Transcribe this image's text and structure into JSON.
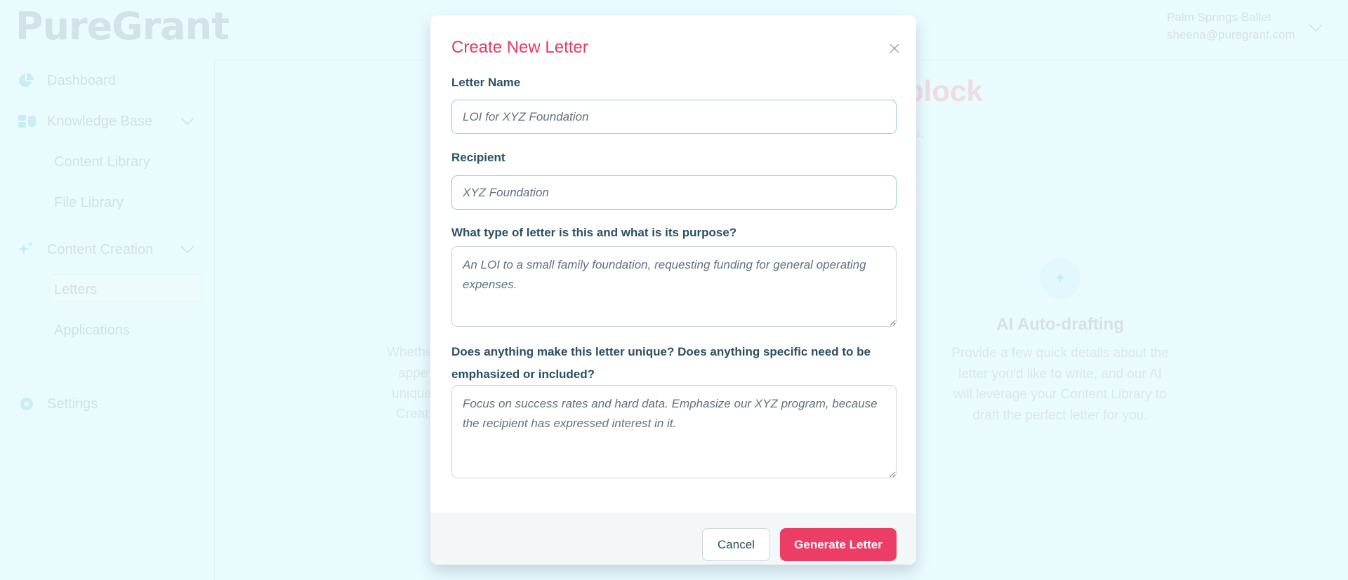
{
  "app": {
    "logo": "PureGrant"
  },
  "sidebar": {
    "items": [
      {
        "label": "Dashboard",
        "icon": "pie-chart-icon"
      },
      {
        "label": "Knowledge Base",
        "icon": "grid-icon",
        "expanded": true,
        "children": [
          {
            "label": "Content Library"
          },
          {
            "label": "File Library"
          }
        ]
      },
      {
        "label": "Content Creation",
        "icon": "sparkles-icon",
        "expanded": true,
        "children": [
          {
            "label": "Letters",
            "active": true
          },
          {
            "label": "Applications"
          }
        ]
      },
      {
        "label": "Settings",
        "icon": "gear-icon"
      }
    ]
  },
  "header": {
    "org": "Palm Springs Ballet",
    "email": "sheena@puregrant.com"
  },
  "background": {
    "heading_fragment": "block",
    "subtitle_fragment": "u.",
    "left_card_fragments": [
      "Whethe",
      "appe",
      "unique",
      "Creat"
    ],
    "right_card": {
      "title": "AI Auto-drafting",
      "lines": [
        "Provide a few quick details about the",
        "letter you'd like to write, and our AI",
        "will leverage your Content Library to",
        "draft the perfect letter for you."
      ]
    }
  },
  "modal": {
    "title": "Create New Letter",
    "fields": [
      {
        "label": "Letter Name",
        "value": "LOI for XYZ Foundation"
      },
      {
        "label": "Recipient",
        "value": "XYZ Foundation"
      },
      {
        "label": "What type of letter is this and what is its purpose?",
        "value": "An LOI to a small family foundation, requesting funding for general operating expenses."
      },
      {
        "label": "Does anything make this letter unique? Does anything specific need to be emphasized or included?",
        "value": "Focus on success rates and hard data. Emphasize our XYZ program, because the recipient has expressed interest in it."
      }
    ],
    "cancel_label": "Cancel",
    "submit_label": "Generate Letter"
  },
  "colors": {
    "accent": "#ec3d66",
    "title": "#e23d62",
    "label": "#2c4f63",
    "backdrop": "#eafbfe"
  }
}
